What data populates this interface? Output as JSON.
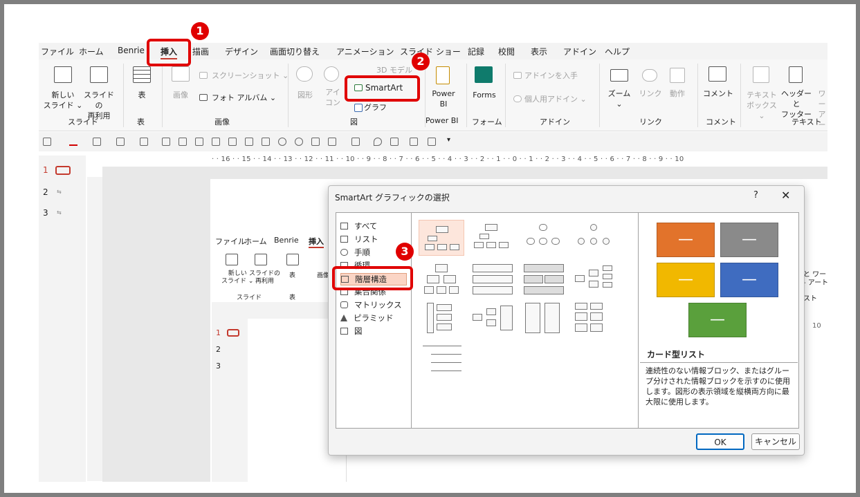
{
  "menu": {
    "items": [
      "ファイル",
      "ホーム",
      "Benrie",
      "挿入",
      "描画",
      "デザイン",
      "画面切り替え",
      "アニメーション",
      "スライド ショー",
      "記録",
      "校閲",
      "表示",
      "アドイン",
      "ヘルプ"
    ]
  },
  "ribbon": {
    "new_slide": "新しい\nスライド ⌄",
    "reuse_slide": "スライドの\n再利用",
    "table": "表",
    "image": "画像",
    "screenshot": "スクリーンショット ⌄",
    "photo_album": "フォト アルバム ⌄",
    "shape": "図形",
    "icon": "アイ\nコン",
    "model3d": "3D モデル",
    "smartart": "SmartArt",
    "graph": "グラフ",
    "powerbi": "Power\nBI",
    "forms": "Forms",
    "get_addin": "アドインを入手",
    "personal_addin": "個人用アドイン ⌄",
    "zoom": "ズーム\n⌄",
    "link": "リンク",
    "action": "動作",
    "comment": "コメント",
    "textbox": "テキスト\nボックス ⌄",
    "header_footer": "ヘッダーと\nフッター",
    "wordart": "ワー\nアー",
    "groups": [
      "スライド",
      "表",
      "画像",
      "図",
      "Power BI",
      "フォーム",
      "アドイン",
      "リンク",
      "コメント",
      "テキスト"
    ]
  },
  "ruler_text": "· · 16 · · 15 · · 14 · · 13 · · 12 · · 11 · · 10 · · 9 · · 8 · · 7 · · 6 · · 5 · · 4 · · 3 · · 2 · · 1 · · 0 · · 1 · · 2 · · 3 · · 4 · · 5 · · 6 · · 7 · · 8 · · 9 · · 10",
  "thumbs": [
    "1",
    "2",
    "3"
  ],
  "nested": {
    "menu": [
      "ファイル",
      "ホーム",
      "Benrie",
      "挿入"
    ],
    "new_slide": "新しい\nスライド ⌄",
    "reuse": "スライドの\n再利用",
    "table": "表",
    "image": "画像",
    "group_slide": "スライド",
    "group_table": "表",
    "thumbs": [
      "1",
      "2",
      "3"
    ]
  },
  "dialog": {
    "title": "SmartArt グラフィックの選択",
    "help": "?",
    "close": "✕",
    "categories": [
      "すべて",
      "リスト",
      "手順",
      "循環",
      "階層構造",
      "集合関係",
      "マトリックス",
      "ピラミッド",
      "図"
    ],
    "selected_category": "階層構造",
    "preview_title": "カード型リスト",
    "preview_desc": "連続性のない情報ブロック、またはグループ分けされた情報ブロックを示すのに使用します。図形の表示領域を縦横両方向に最大限に使用します。",
    "preview_colors": [
      "#e2732b",
      "#8a8a8a",
      "#f1b800",
      "#3f6cc0",
      "#5aa03c"
    ],
    "ok": "OK",
    "cancel": "キャンセル"
  },
  "callouts": [
    "1",
    "2",
    "3"
  ],
  "right_peek": [
    "と ワー",
    "- アート",
    "スト",
    "10"
  ]
}
